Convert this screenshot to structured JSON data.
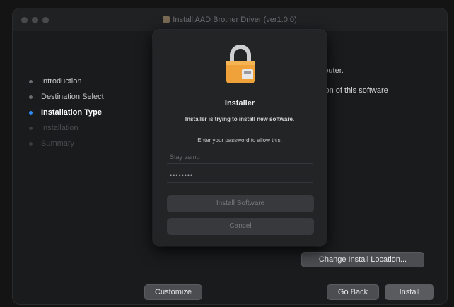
{
  "window": {
    "title": "Install AAD Brother Driver (ver1.0.0)",
    "sidebar_steps": [
      {
        "label": "Introduction",
        "state": "done"
      },
      {
        "label": "Destination Select",
        "state": "done"
      },
      {
        "label": "Installation Type",
        "state": "active"
      },
      {
        "label": "Installation",
        "state": "pending"
      },
      {
        "label": "Summary",
        "state": "pending"
      }
    ],
    "content": {
      "line1": "omputer.",
      "line2": "llation of this software"
    },
    "buttons": {
      "change_location": "Change Install Location...",
      "customize": "Customize",
      "go_back": "Go Back",
      "install": "Install"
    }
  },
  "dialog": {
    "icon": "lock-icon",
    "title": "Installer",
    "message": "Installer is trying to install new software.",
    "prompt": "Enter your password to allow this.",
    "username_placeholder": "Stay vamp",
    "password_mask": "••••••••",
    "install_button": "Install Software",
    "cancel_button": "Cancel"
  },
  "colors": {
    "accent_blue": "#2e8bf7",
    "lock_orange": "#f0a23a",
    "window_bg": "#1a1b1d"
  }
}
